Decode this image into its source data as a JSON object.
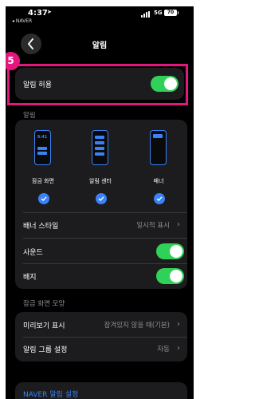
{
  "status_bar": {
    "time": "4:37",
    "back_app": "◂ NAVER",
    "network": "5G",
    "battery": "70"
  },
  "nav": {
    "title": "알림"
  },
  "step_badge": "5",
  "allow": {
    "label": "알림 허용",
    "on": true
  },
  "alerts_section": {
    "header": "알림",
    "styles": [
      {
        "label": "잠금 화면",
        "checked": true,
        "clock": "9:41"
      },
      {
        "label": "알림 센터",
        "checked": true
      },
      {
        "label": "배너",
        "checked": true
      }
    ],
    "banner_style": {
      "label": "배너 스타일",
      "value": "일시적 표시"
    },
    "sound": {
      "label": "사운드",
      "on": true
    },
    "badge": {
      "label": "배지",
      "on": true
    }
  },
  "lock_section": {
    "header": "잠금 화면 모양",
    "preview": {
      "label": "미리보기 표시",
      "value": "잠겨있지 않을 때(기본)"
    },
    "grouping": {
      "label": "알림 그룹 설정",
      "value": "자동"
    }
  },
  "app_settings_link": "NAVER 알림 설정",
  "colors": {
    "accent": "#3a82f7",
    "toggle_on": "#30d158",
    "highlight": "#e5177e"
  }
}
